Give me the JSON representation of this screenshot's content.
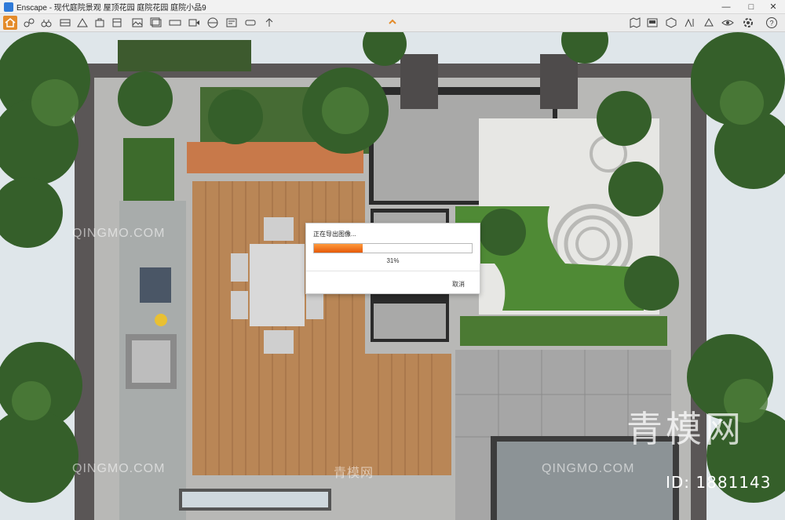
{
  "window": {
    "app_name": "Enscape",
    "title": "Enscape - 现代庭院景观 屋顶花园 庭院花园 庭院小品9"
  },
  "toolbar": {
    "left_icons": [
      "home-icon",
      "link-icon",
      "binoculars-icon",
      "view-icon",
      "camera-icon",
      "people-icon",
      "building-icon",
      "clapboard-icon",
      "export-image-icon",
      "export-batch-icon",
      "export-panorama-icon",
      "export-video-icon",
      "export-web-icon",
      "export-exe-icon",
      "export-vr-icon",
      "upload-icon"
    ],
    "right_icons": [
      "map-icon",
      "preview-icon",
      "asset-library-icon",
      "material-editor-icon",
      "visual-settings-icon",
      "eye-icon",
      "settings-icon",
      "help-icon"
    ],
    "collapse_icon": "chevron-up-icon"
  },
  "viewport": {
    "watermark_text": "QINGMO.COM",
    "watermark_cn": "青模网",
    "watermark_big": "青模网",
    "watermark_id": "ID: 1881143"
  },
  "export_dialog": {
    "title": "正在导出图像...",
    "progress_percent": 31,
    "progress_text": "31%",
    "cancel_label": "取消",
    "accent_color": "#f07a1a"
  }
}
